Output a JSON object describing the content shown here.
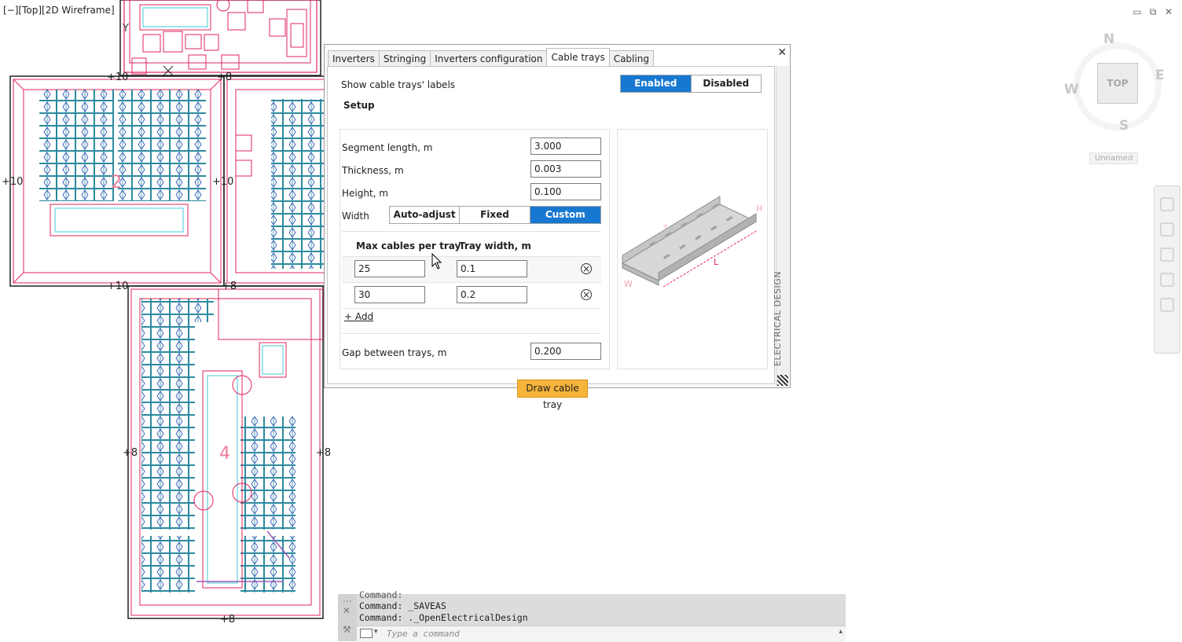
{
  "viewport": {
    "label": "[−][Top][2D Wireframe]"
  },
  "window_controls": {
    "minimize": "▭",
    "restore": "⧉",
    "close": "✕"
  },
  "viewcube": {
    "top": "TOP",
    "north": "N",
    "south": "S",
    "east": "E",
    "west": "W",
    "ucs": "Unnamed"
  },
  "drawing": {
    "dim_labels": [
      "+10",
      "+8",
      "+10",
      "+10",
      "+10",
      "+8",
      "+8",
      "+8",
      "+8"
    ],
    "zone_numbers": [
      "2",
      "4"
    ],
    "axis_y": "Y"
  },
  "dialog": {
    "tabs": [
      "Inverters",
      "Stringing",
      "Inverters configuration",
      "Cable trays",
      "Cabling"
    ],
    "active_tab": "Cable trays",
    "close": "✕",
    "labels_toggle": {
      "label": "Show cable trays' labels",
      "options": [
        "Enabled",
        "Disabled"
      ],
      "selected": "Enabled"
    },
    "setup": {
      "title": "Setup",
      "segment_length": {
        "label": "Segment length, m",
        "value": "3.000"
      },
      "thickness": {
        "label": "Thickness, m",
        "value": "0.003"
      },
      "height": {
        "label": "Height, m",
        "value": "0.100"
      },
      "width": {
        "label": "Width",
        "options": [
          "Auto-adjust",
          "Fixed",
          "Custom"
        ],
        "selected": "Custom"
      }
    },
    "custom_table": {
      "headers": [
        "Max cables per tray",
        "Tray width, m"
      ],
      "rows": [
        {
          "max_cables": "25",
          "tray_width": "0.1"
        },
        {
          "max_cables": "30",
          "tray_width": "0.2"
        }
      ],
      "add_label": "+ Add"
    },
    "gap": {
      "label": "Gap between trays, m",
      "value": "0.200"
    },
    "draw_button": "Draw cable tray",
    "side_label": "ELECTRICAL DESIGN",
    "tray_dims": {
      "height": "H",
      "width": "W",
      "length": "L",
      "thickness": "T"
    }
  },
  "command_line": {
    "history": [
      "Command:",
      "Command: _SAVEAS",
      "Command: ._OpenElectricalDesign"
    ],
    "placeholder": "Type a command"
  }
}
